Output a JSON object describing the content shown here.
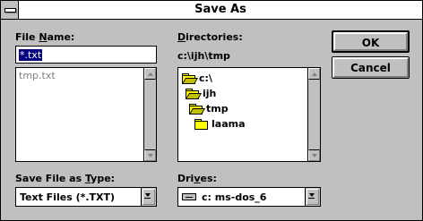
{
  "window": {
    "title": "Save As"
  },
  "file_name": {
    "label_pre": "File ",
    "label_u": "N",
    "label_post": "ame:",
    "input_value": "*.txt",
    "list_items": [
      "tmp.txt"
    ]
  },
  "directories": {
    "label_u": "D",
    "label_post": "irectories:",
    "current_path": "c:\\ijh\\tmp",
    "tree": [
      {
        "label": "c:\\",
        "open": true,
        "selected": false
      },
      {
        "label": "ijh",
        "open": true,
        "selected": false
      },
      {
        "label": "tmp",
        "open": true,
        "selected": false
      },
      {
        "label": "laama",
        "open": false,
        "selected": false
      }
    ]
  },
  "save_type": {
    "label_pre": "Save File as ",
    "label_u": "T",
    "label_post": "ype:",
    "selected": "Text Files (*.TXT)"
  },
  "drives": {
    "label_pre": "Dri",
    "label_u": "v",
    "label_post": "es:",
    "selected": "c: ms-dos_6",
    "icon": "hard-drive-icon"
  },
  "buttons": {
    "ok": "OK",
    "cancel": "Cancel"
  }
}
